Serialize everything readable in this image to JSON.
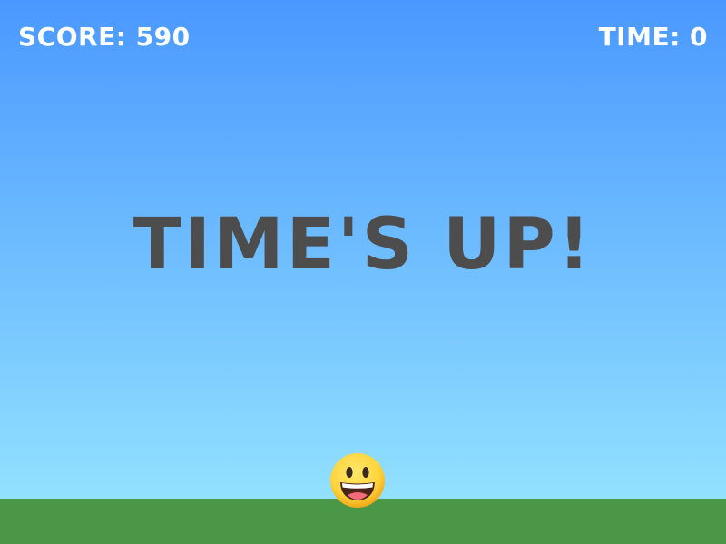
{
  "hud": {
    "score_text": "SCORE: 590",
    "time_text": "TIME: 0"
  },
  "banner": {
    "text": "TIME'S UP!"
  },
  "player": {
    "icon": "grinning-face-icon"
  },
  "colors": {
    "sky_top": "#4a98ff",
    "sky_bottom": "#92e1ff",
    "ground": "#4b9748",
    "hud_text": "#ffffff",
    "banner_text": "#4d4d4d",
    "face": "#ffd43b",
    "face_shadow": "#f0a818"
  }
}
